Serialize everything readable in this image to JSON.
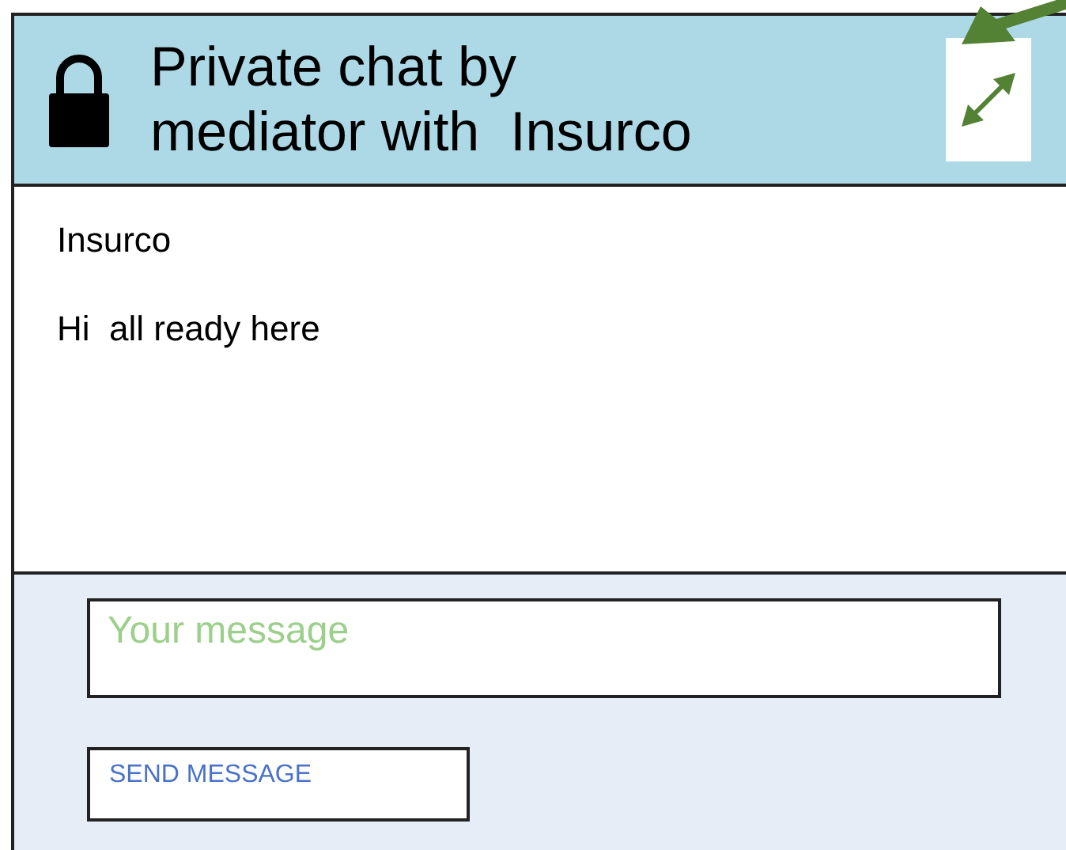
{
  "header": {
    "title_lines": [
      "Private chat by",
      "mediator with  Insurco"
    ]
  },
  "messages": [
    {
      "sender": "Insurco",
      "text": "Hi  all ready here"
    }
  ],
  "composer": {
    "placeholder": "Your message",
    "send_label": "SEND MESSAGE"
  }
}
